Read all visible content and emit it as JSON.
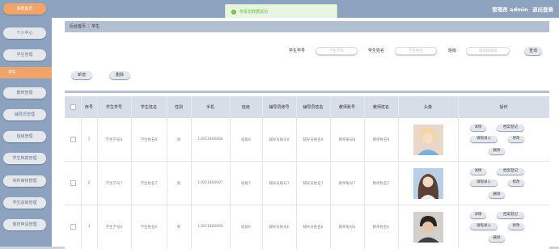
{
  "header": {
    "role_label": "管理员 admin",
    "logout_label": "退出登录"
  },
  "toast": {
    "message": "恭喜您数据成功"
  },
  "sidebar": {
    "items": [
      {
        "label": "系统首页"
      },
      {
        "label": "个人中心"
      },
      {
        "label": "学生管理"
      },
      {
        "label": "学生"
      },
      {
        "label": "教师管理"
      },
      {
        "label": "辅导员管理"
      },
      {
        "label": "班级管理"
      },
      {
        "label": "学生档案管理"
      },
      {
        "label": "资料审核管理"
      },
      {
        "label": "学生请假管理"
      },
      {
        "label": "离校申请管理"
      }
    ]
  },
  "breadcrumb": {
    "home": "后台首页",
    "separator": "⫶",
    "current": "学生"
  },
  "search": {
    "student_no_label": "学生学号",
    "student_no_placeholder": "学生学号",
    "student_name_label": "学生姓名",
    "student_name_placeholder": "学生姓名",
    "class_label": "班级",
    "class_placeholder": "请选择班级",
    "search_button": "查询"
  },
  "actions": {
    "add": "新增",
    "delete": "删除"
  },
  "table": {
    "headers": [
      "序号",
      "学生学号",
      "学生姓名",
      "性别",
      "手机",
      "班级",
      "辅导员账号",
      "辅导员姓名",
      "教师账号",
      "教师姓名",
      "头像",
      "操作"
    ],
    "rows": [
      {
        "idx": "1",
        "student_no": "学生学号8",
        "student_name": "学生姓名8",
        "gender": "男",
        "phone": "13823888888",
        "class": "班级8",
        "counselor_no": "辅导员账号8",
        "counselor_name": "辅导员姓名8",
        "teacher_no": "教师账号8",
        "teacher_name": "教师姓名8"
      },
      {
        "idx": "2",
        "student_no": "学生学号7",
        "student_name": "学生姓名7",
        "gender": "男",
        "phone": "13823888887",
        "class": "班级7",
        "counselor_no": "辅导员账号7",
        "counselor_name": "辅导员姓名7",
        "teacher_no": "教师账号7",
        "teacher_name": "教师姓名7"
      },
      {
        "idx": "3",
        "student_no": "学生学号6",
        "student_name": "学生姓名6",
        "gender": "男",
        "phone": "13823888886",
        "class": "班级6",
        "counselor_no": "辅导员账号6",
        "counselor_name": "辅导员姓名6",
        "teacher_no": "教师账号6",
        "teacher_name": "教师姓名6"
      }
    ],
    "row_actions": {
      "detail": "详情",
      "archive": "档案登记",
      "leave": "请假录入",
      "edit": "修改",
      "delete": "删除"
    }
  },
  "colors": {
    "sidebar_bg": "#8da2be",
    "accent": "#f0a46a",
    "header_row": "#d7dee8",
    "success": "#67c23a"
  }
}
